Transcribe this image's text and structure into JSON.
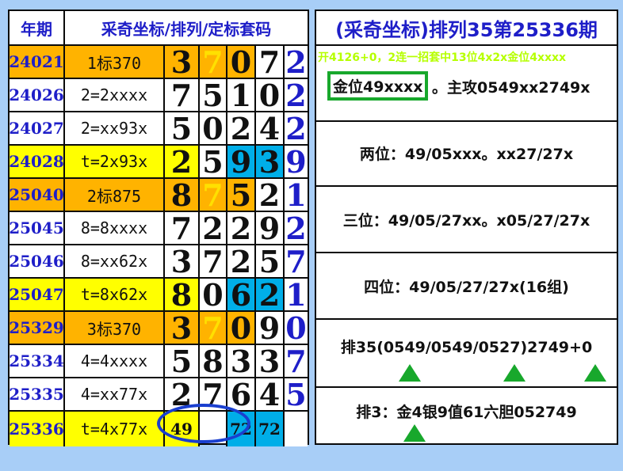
{
  "left_table": {
    "header_period": "年期",
    "header_title": "采奇坐标/排列/定标套码",
    "rows": [
      {
        "period": "24021",
        "cond": "1标370",
        "d1": "3",
        "d2": "7",
        "d3": "0",
        "d4": "7",
        "d5": "2"
      },
      {
        "period": "24026",
        "cond": "2=2xxxx",
        "d1": "7",
        "d2": "5",
        "d3": "1",
        "d4": "0",
        "d5": "2"
      },
      {
        "period": "24027",
        "cond": "2=xx93x",
        "d1": "5",
        "d2": "0",
        "d3": "2",
        "d4": "4",
        "d5": "2"
      },
      {
        "period": "24028",
        "cond": "t=2x93x",
        "d1": "2",
        "d2": "5",
        "d3": "9",
        "d4": "3",
        "d5": "9"
      },
      {
        "period": "25040",
        "cond": "2标875",
        "d1": "8",
        "d2": "7",
        "d3": "5",
        "d4": "2",
        "d5": "1"
      },
      {
        "period": "25045",
        "cond": "8=8xxxx",
        "d1": "7",
        "d2": "2",
        "d3": "2",
        "d4": "9",
        "d5": "2"
      },
      {
        "period": "25046",
        "cond": "8=xx62x",
        "d1": "3",
        "d2": "7",
        "d3": "2",
        "d4": "5",
        "d5": "7"
      },
      {
        "period": "25047",
        "cond": "t=8x62x",
        "d1": "8",
        "d2": "0",
        "d3": "6",
        "d4": "2",
        "d5": "1"
      },
      {
        "period": "25329",
        "cond": "3标370",
        "d1": "3",
        "d2": "7",
        "d3": "0",
        "d4": "9",
        "d5": "0"
      },
      {
        "period": "25334",
        "cond": "4=4xxxx",
        "d1": "5",
        "d2": "8",
        "d3": "3",
        "d4": "3",
        "d5": "7"
      },
      {
        "period": "25335",
        "cond": "4=xx77x",
        "d1": "2",
        "d2": "7",
        "d3": "6",
        "d4": "4",
        "d5": "5"
      },
      {
        "period": "25336",
        "cond": "t=4x77x",
        "d1": "49",
        "d2": "",
        "d3": "72",
        "d4": "72",
        "d5": ""
      }
    ]
  },
  "right_panel": {
    "title": "(采奇坐标)排列35第25336期",
    "subtitle": "开4126+0，2连一招套中13位4x2x金位4xxxx",
    "gold_box": "金位49xxxx",
    "gold_rest": "。主攻0549xx2749x",
    "line2": "两位：49/05xxx。xx27/27x",
    "line3": "三位：49/05/27xx。x05/27/27x",
    "line4": "四位：49/05/27/27x(16组)",
    "line5": "排35(0549/0549/0527)2749+0",
    "line6": "排3：金4银9值61六胆052749"
  },
  "colors": {
    "background": "#a8cef7",
    "orange": "#ffb300",
    "yellow": "#ffff00",
    "cyan": "#00aee8",
    "title_blue": "#1e1ec8",
    "green": "#18a82c",
    "circle": "#1a3fcf",
    "subtitle": "#b6ff00"
  }
}
